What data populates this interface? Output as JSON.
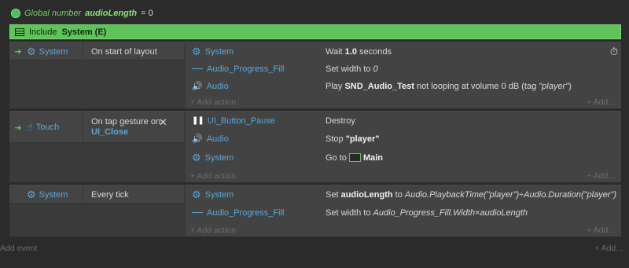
{
  "global": {
    "prefix": "Global number",
    "name": "audioLength",
    "value": "= 0"
  },
  "include": {
    "prefix": "Include",
    "sheet": "System (E)"
  },
  "events": [
    {
      "condition_object": "System",
      "condition": "On start of layout",
      "actions": [
        {
          "object": "System",
          "text_pre": "Wait ",
          "bold": "1.0",
          "text_post": " seconds"
        },
        {
          "object": "Audio_Progress_Fill",
          "text_pre": "Set width to ",
          "italic": "0"
        },
        {
          "object": "Audio",
          "text_pre": "Play ",
          "bold": "SND_Audio_Test",
          "text_post": " not looping at volume 0 dB (tag ",
          "italic": "\"player\"",
          "text_end": ")"
        }
      ],
      "add_action": "+ Add action",
      "add_right": "+ Add..."
    },
    {
      "condition_object": "Touch",
      "condition_line1": "On tap gesture on",
      "condition_line2": "UI_Close",
      "actions": [
        {
          "object": "UI_Button_Pause",
          "text_pre": "Destroy"
        },
        {
          "object": "Audio",
          "text_pre": "Stop ",
          "bold": "\"player\""
        },
        {
          "object": "System",
          "text_pre": "Go to ",
          "bold": "Main"
        }
      ],
      "add_action": "+ Add action",
      "add_right": "+ Add..."
    },
    {
      "condition_object": "System",
      "condition": "Every tick",
      "actions": [
        {
          "object": "System",
          "text_pre": "Set ",
          "bold": "audioLength",
          "text_post": " to ",
          "italic": "Audio.PlaybackTime(\"player\")÷Audio.Duration(\"player\")"
        },
        {
          "object": "Audio_Progress_Fill",
          "text_pre": "Set width to ",
          "italic": "Audio_Progress_Fill.Width×audioLength"
        }
      ],
      "add_action": "+ Add action",
      "add_right": "+ Add..."
    }
  ],
  "footer": {
    "add_event": "Add event",
    "add_right": "+ Add..."
  }
}
